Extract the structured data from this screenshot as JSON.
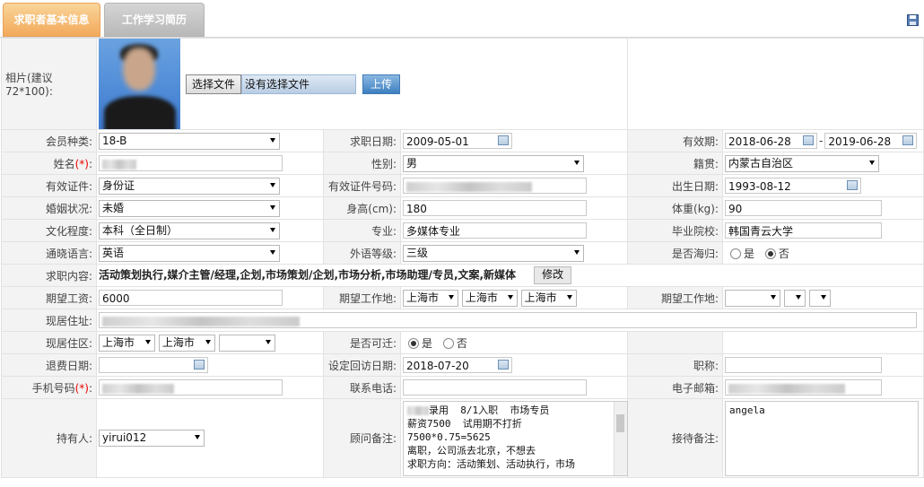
{
  "tabs": [
    {
      "label": "求职者基本信息"
    },
    {
      "label": "工作学习简历"
    }
  ],
  "photo": {
    "label": "相片(建议72*100):",
    "choose_file": "选择文件",
    "no_file": "没有选择文件",
    "upload": "上传"
  },
  "fields": {
    "member_type": {
      "label": "会员种类:",
      "value": "18-B"
    },
    "job_date": {
      "label": "求职日期:",
      "value": "2009-05-01"
    },
    "validity": {
      "label": "有效期:",
      "from": "2018-06-28",
      "sep": "-",
      "to": "2019-06-28"
    },
    "name": {
      "label": "姓名",
      "req": "(*)",
      "colon": ":"
    },
    "gender": {
      "label": "性别:",
      "value": "男"
    },
    "native": {
      "label": "籍贯:",
      "value": "内蒙古自治区"
    },
    "id_type": {
      "label": "有效证件:",
      "value": "身份证"
    },
    "id_no": {
      "label": "有效证件号码:"
    },
    "birth": {
      "label": "出生日期:",
      "value": "1993-08-12"
    },
    "marital": {
      "label": "婚姻状况:",
      "value": "未婚"
    },
    "height": {
      "label": "身高(cm):",
      "value": "180"
    },
    "weight": {
      "label": "体重(kg):",
      "value": "90"
    },
    "education": {
      "label": "文化程度:",
      "value": "本科（全日制）"
    },
    "major": {
      "label": "专业:",
      "value": "多媒体专业"
    },
    "school": {
      "label": "毕业院校:",
      "value": "韩国青云大学"
    },
    "language": {
      "label": "通晓语言:",
      "value": "英语"
    },
    "lang_level": {
      "label": "外语等级:",
      "value": "三级"
    },
    "overseas": {
      "label": "是否海归:",
      "yes": "是",
      "no": "否",
      "selected": "否"
    },
    "job_content": {
      "label": "求职内容:",
      "value": "活动策划执行,媒介主管/经理,企划,市场策划/企划,市场分析,市场助理/专员,文案,新媒体",
      "edit": "修改"
    },
    "salary": {
      "label": "期望工资:",
      "value": "6000"
    },
    "work_place": {
      "label": "期望工作地:",
      "v1": "上海市",
      "v2": "上海市",
      "v3": "上海市"
    },
    "work_place2": {
      "label": "期望工作地:"
    },
    "address": {
      "label": "现居住址:"
    },
    "area": {
      "label": "现居住区:",
      "v1": "上海市",
      "v2": "上海市"
    },
    "relocate": {
      "label": "是否可迁:",
      "yes": "是",
      "no": "否",
      "selected": "是"
    },
    "refund_date": {
      "label": "退费日期:"
    },
    "visit_date": {
      "label": "设定回访日期:",
      "value": "2018-07-20"
    },
    "title": {
      "label": "职称:"
    },
    "mobile": {
      "label": "手机号码",
      "req": "(*)",
      "colon": ":"
    },
    "phone": {
      "label": "联系电话:"
    },
    "email": {
      "label": "电子邮箱:"
    },
    "holder": {
      "label": "持有人:",
      "value": "yirui012"
    },
    "consultant_note": {
      "label": "顾问备注:",
      "lines": [
        "录用  8/1入职  市场专员",
        "薪资7500  试用期不打折",
        "7500*0.75=5625",
        "离职，公司派去北京，不想去",
        "求职方向：活动策划、活动执行，市场"
      ]
    },
    "reception_note": {
      "label": "接待备注:",
      "value": "angela"
    }
  }
}
